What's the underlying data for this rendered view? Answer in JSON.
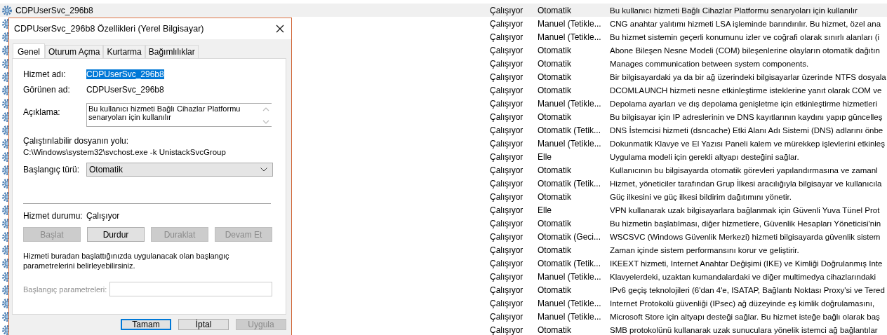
{
  "services": [
    {
      "name": "CDPUserSvc_296b8",
      "status": "Çalışıyor",
      "startup": "Otomatik",
      "description": "Bu kullanıcı hizmeti Bağlı Cihazlar Platformu senaryoları için kullanılır",
      "selected": true
    },
    {
      "status": "Çalışıyor",
      "startup": "Manuel (Tetikle...",
      "description": "CNG anahtar yalıtımı hizmeti LSA işleminde barındırılır. Bu hizmet, özel ana",
      "selected": false
    },
    {
      "status": "Çalışıyor",
      "startup": "Manuel (Tetikle...",
      "description": "Bu hizmet sistemin geçerli konumunu izler ve coğrafi olarak sınırlı alanları (i",
      "selected": false
    },
    {
      "status": "Çalışıyor",
      "startup": "Otomatik",
      "description": "Abone Bileşen Nesne Modeli (COM) bileşenlerine olayların otomatik dağıtın",
      "selected": false
    },
    {
      "status": "Çalışıyor",
      "startup": "Otomatik",
      "description": "Manages communication between system components.",
      "selected": false
    },
    {
      "status": "Çalışıyor",
      "startup": "Otomatik",
      "description": "Bir bilgisayardaki ya da bir ağ üzerindeki bilgisayarlar üzerinde NTFS dosyala",
      "selected": false
    },
    {
      "status": "Çalışıyor",
      "startup": "Otomatik",
      "description": "DCOMLAUNCH hizmeti nesne etkinleştirme isteklerine yanıt olarak COM ve",
      "selected": false
    },
    {
      "status": "Çalışıyor",
      "startup": "Manuel (Tetikle...",
      "description": "Depolama ayarları ve dış depolama genişletme için etkinleştirme hizmetleri",
      "selected": false
    },
    {
      "status": "Çalışıyor",
      "startup": "Otomatik",
      "description": "Bu bilgisayar için IP adreslerinin ve DNS kayıtlarının kaydını yapıp güncelleş",
      "selected": false
    },
    {
      "status": "Çalışıyor",
      "startup": "Otomatik (Tetik...",
      "description": "DNS İstemcisi hizmeti (dsncache) Etki Alanı Adı Sistemi (DNS) adlarını önbe",
      "selected": false
    },
    {
      "status": "Çalışıyor",
      "startup": "Manuel (Tetikle...",
      "description": "Dokunmatik Klavye ve El Yazısı Paneli kalem ve mürekkep işlevlerini etkinleş",
      "selected": false
    },
    {
      "status": "Çalışıyor",
      "startup": "Elle",
      "description": "Uygulama modeli için gerekli altyapı desteğini sağlar.",
      "selected": false
    },
    {
      "status": "Çalışıyor",
      "startup": "Otomatik",
      "description": "Kullanıcının bu bilgisayarda otomatik görevleri yapılandırmasına ve zamanl",
      "selected": false
    },
    {
      "status": "Çalışıyor",
      "startup": "Otomatik (Tetik...",
      "description": "Hizmet, yöneticiler tarafından Grup İlkesi aracılığıyla bilgisayar ve kullanıcıla",
      "selected": false
    },
    {
      "status": "Çalışıyor",
      "startup": "Otomatik",
      "description": "Güç ilkesini ve güç ilkesi bildirim dağıtımını yönetir.",
      "selected": false
    },
    {
      "status": "Çalışıyor",
      "startup": "Elle",
      "description": "VPN kullanarak uzak bilgisayarlara bağlanmak için Güvenli Yuva Tünel Prot",
      "selected": false
    },
    {
      "status": "Çalışıyor",
      "startup": "Otomatik",
      "description": "Bu hizmetin başlatılması, diğer hizmetlere, Güvenlik Hesapları Yöneticisi'nin",
      "selected": false
    },
    {
      "status": "Çalışıyor",
      "startup": "Otomatik (Geci...",
      "description": "WSCSVC (Windows Güvenlik Merkezi) hizmeti bilgisayarda güvenlik sistem",
      "selected": false
    },
    {
      "status": "Çalışıyor",
      "startup": "Otomatik",
      "description": "Zaman içinde sistem performansını korur ve geliştirir.",
      "selected": false
    },
    {
      "status": "Çalışıyor",
      "startup": "Otomatik (Tetik...",
      "description": "IKEEXT hizmeti, Internet Anahtar Değişimi (IKE) ve Kimliği Doğrulanmış Inte",
      "selected": false
    },
    {
      "status": "Çalışıyor",
      "startup": "Manuel (Tetikle...",
      "description": "Klavyelerdeki, uzaktan kumandalardaki ve diğer multimedya cihazlarındaki",
      "selected": false
    },
    {
      "status": "Çalışıyor",
      "startup": "Otomatik",
      "description": "IPv6 geçiş teknolojileri (6'dan 4'e, ISATAP, Bağlantı Noktası Proxy'si ve Tered",
      "selected": false
    },
    {
      "status": "Çalışıyor",
      "startup": "Manuel (Tetikle...",
      "description": "Internet Protokolü güvenliği (IPsec) ağ düzeyinde eş kimlik doğrulamasını,",
      "selected": false
    },
    {
      "status": "Çalışıyor",
      "startup": "Manuel (Tetikle...",
      "description": "Microsoft Store için altyapı desteği sağlar. Bu hizmet isteğe bağlı olarak baş",
      "selected": false
    },
    {
      "status": "Çalışıyor",
      "startup": "Otomatik",
      "description": "SMB protokolünü kullanarak uzak sunuculara yönelik istemci ağ bağlantılar",
      "selected": false
    }
  ],
  "dialog": {
    "title": "CDPUserSvc_296b8 Özellikleri (Yerel Bilgisayar)",
    "tabs": [
      {
        "label": "Genel",
        "selected": true
      },
      {
        "label": "Oturum Açma",
        "selected": false
      },
      {
        "label": "Kurtarma",
        "selected": false
      },
      {
        "label": "Bağımlılıklar",
        "selected": false
      }
    ],
    "service_name": {
      "label": "Hizmet adı:",
      "value": "CDPUserSvc_296b8",
      "value_selected": true
    },
    "display_name": {
      "label": "Görünen ad:",
      "value": "CDPUserSvc_296b8"
    },
    "description": {
      "label": "Açıklama:",
      "value": "Bu kullanıcı hizmeti Bağlı Cihazlar Platformu senaryoları için kullanılır"
    },
    "executable_path": {
      "label": "Çalıştırılabilir dosyanın yolu:",
      "value": "C:\\Windows\\system32\\svchost.exe -k UnistackSvcGroup"
    },
    "startup_type": {
      "label": "Başlangıç türü:",
      "value": "Otomatik"
    },
    "service_status": {
      "label": "Hizmet durumu:",
      "value": "Çalışıyor"
    },
    "control_buttons": [
      {
        "label": "Başlat",
        "disabled": true
      },
      {
        "label": "Durdur",
        "disabled": false
      },
      {
        "label": "Duraklat",
        "disabled": true
      },
      {
        "label": "Devam Et",
        "disabled": true
      }
    ],
    "hint": "Hizmeti buradan başlattığınızda uygulanacak olan başlangıç parametrelerini belirleyebilirsiniz.",
    "start_parameters": {
      "label": "Başlangıç parametreleri:",
      "disabled": true
    },
    "footer_buttons": [
      {
        "label": "Tamam",
        "disabled": false,
        "default": true
      },
      {
        "label": "İptal",
        "disabled": false,
        "default": false
      },
      {
        "label": "Uygula",
        "disabled": true,
        "default": false
      }
    ]
  }
}
